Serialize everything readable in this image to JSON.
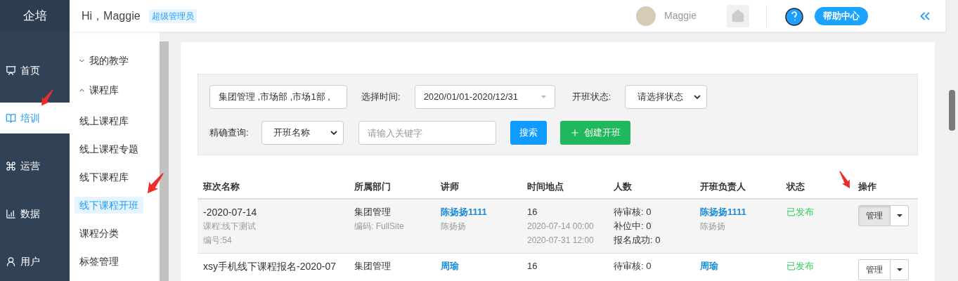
{
  "sidebar": {
    "logo": "企培",
    "items": [
      {
        "label": "首页",
        "selected": false
      },
      {
        "label": "培训",
        "selected": true
      },
      {
        "label": "运营",
        "selected": false
      },
      {
        "label": "数据",
        "selected": false
      },
      {
        "label": "用户",
        "selected": false
      }
    ]
  },
  "header": {
    "greeting": "Hi，Maggie",
    "role_badge": "超级管理员",
    "user_name": "Maggie",
    "help_button": "帮助中心"
  },
  "submenu": {
    "groups": [
      {
        "label": "我的教学",
        "expanded": false
      },
      {
        "label": "课程库",
        "expanded": true,
        "children": [
          {
            "label": "线上课程库",
            "selected": false
          },
          {
            "label": "线上课程专题",
            "selected": false
          },
          {
            "label": "线下课程库",
            "selected": false
          },
          {
            "label": "线下课程开班",
            "selected": true
          },
          {
            "label": "课程分类",
            "selected": false
          },
          {
            "label": "标签管理",
            "selected": false
          }
        ]
      }
    ]
  },
  "filters": {
    "department": "集团管理 ,市场部 ,市场1部 ,",
    "time_label": "选择时间:",
    "date_range": "2020/01/01-2020/12/31",
    "status_label": "开班状态:",
    "status_select": "请选择状态",
    "exact_label": "精确查询:",
    "exact_select": "开班名称",
    "keyword_placeholder": "请输入关键字",
    "search_button": "搜索",
    "create_button": "创建开班"
  },
  "table": {
    "columns": [
      "班次名称",
      "所属部门",
      "讲师",
      "时间地点",
      "人数",
      "开班负责人",
      "状态",
      "操作"
    ],
    "rows": [
      {
        "selected": true,
        "name": "-2020-07-14",
        "course": "课程:线下测试",
        "number": "编号:54",
        "department": "集团管理",
        "department_code": "编码: FullSite",
        "teacher": "陈扬扬1111",
        "teacher_username": "陈扬扬",
        "place": "16",
        "start_time": "2020-07-14 00:00",
        "end_time": "2020-07-31 12:00",
        "counts": [
          "待审核: 0",
          "补位中: 0",
          "报名成功: 0"
        ],
        "owner": "陈扬扬1111",
        "owner_username": "陈扬扬",
        "status": "已发布",
        "action": "管理"
      },
      {
        "selected": false,
        "name": "xsy手机线下课程报名-2020-07",
        "department": "集团管理",
        "teacher": "周瑜",
        "place": "16",
        "counts": [
          "待审核: 0"
        ],
        "owner": "周瑜",
        "status": "已发布",
        "action": "管理"
      }
    ]
  }
}
